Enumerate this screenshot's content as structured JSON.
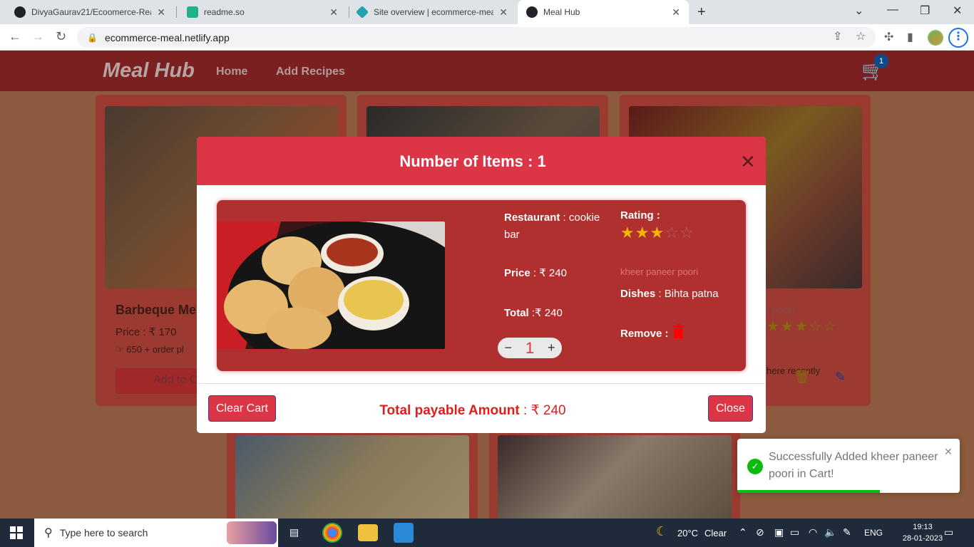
{
  "browser": {
    "tabs": [
      {
        "title": "DivyaGaurav21/Ecoomerce-React",
        "icon": "github-icon"
      },
      {
        "title": "readme.so",
        "icon": "readme-icon"
      },
      {
        "title": "Site overview | ecommerce-meal",
        "icon": "netlify-icon"
      },
      {
        "title": "Meal Hub",
        "icon": "react-icon",
        "active": true
      }
    ],
    "url": "ecommerce-meal.netlify.app"
  },
  "app": {
    "brand": "Meal Hub",
    "nav": [
      "Home",
      "Add Recipes"
    ],
    "cart_count": "1"
  },
  "background_cards": {
    "card1_title": "Barbeque Me",
    "card1_price": "Price : ₹ 170",
    "card1_orders": "650 + order pl",
    "card1_button": "Add to C",
    "card3_dish": "er poori",
    "card3_note": "here recently"
  },
  "modal": {
    "title": "Number of Items : 1",
    "item": {
      "restaurant_label": "Restaurant",
      "restaurant_value": " : cookie bar",
      "rating_label": "Rating :",
      "rating": 3,
      "rating_max": 5,
      "price_label": "Price",
      "price_value": " : ₹ 240",
      "dish_name": "kheer paneer poori",
      "dishes_label": "Dishes",
      "dishes_value": " : Bihta patna",
      "total_label": "Total",
      "total_value": " :₹ 240",
      "remove_label": "Remove :",
      "quantity": "1",
      "minus": "−",
      "plus": "+"
    },
    "footer": {
      "clear_cart": "Clear Cart",
      "total_label": "Total payable Amount",
      "total_value": " : ₹ 240",
      "close": "Close"
    }
  },
  "toast": {
    "message": "Successfully Added kheer paneer poori in Cart!",
    "progress": 0.64
  },
  "taskbar": {
    "search_placeholder": "Type here to search",
    "weather_temp": "20°C",
    "weather_text": "Clear",
    "language": "ENG",
    "time": "19:13",
    "date": "28-01-2023"
  },
  "colors": {
    "modal_header": "#dc3545",
    "app_nav": "#7a2020",
    "toast_success": "#07bc0c"
  }
}
